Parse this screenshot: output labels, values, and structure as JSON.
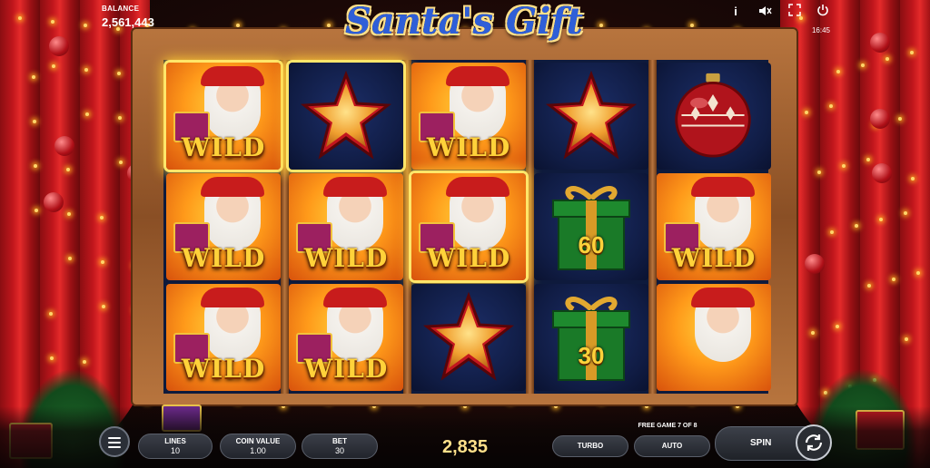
{
  "game": {
    "logo_text": "Santa's Gift",
    "balance_label": "BALANCE",
    "balance_value": "2,561,443",
    "clock": "16:45"
  },
  "top_icons": [
    {
      "name": "info-icon",
      "glyph": "i"
    },
    {
      "name": "mute-icon",
      "glyph": "🔇"
    },
    {
      "name": "fullscreen-icon",
      "glyph": "⤢"
    },
    {
      "name": "power-icon",
      "glyph": "⏻"
    }
  ],
  "reels": [
    [
      {
        "symbol": "santa-wild",
        "label": "WILD",
        "highlighted": true
      },
      {
        "symbol": "santa-wild",
        "label": "WILD",
        "highlighted": false
      },
      {
        "symbol": "santa-wild",
        "label": "WILD",
        "highlighted": false
      }
    ],
    [
      {
        "symbol": "star",
        "label": "",
        "highlighted": true
      },
      {
        "symbol": "santa-wild",
        "label": "WILD",
        "highlighted": false
      },
      {
        "symbol": "santa-wild",
        "label": "WILD",
        "highlighted": false
      }
    ],
    [
      {
        "symbol": "santa-wild",
        "label": "WILD",
        "highlighted": false
      },
      {
        "symbol": "santa-wild",
        "label": "WILD",
        "highlighted": true
      },
      {
        "symbol": "star",
        "label": "",
        "highlighted": false
      }
    ],
    [
      {
        "symbol": "star",
        "label": "",
        "highlighted": false
      },
      {
        "symbol": "gift",
        "label": "60",
        "highlighted": false
      },
      {
        "symbol": "gift",
        "label": "30",
        "highlighted": false
      }
    ],
    [
      {
        "symbol": "bauble",
        "label": "",
        "highlighted": false
      },
      {
        "symbol": "santa-wild",
        "label": "WILD",
        "highlighted": false
      },
      {
        "symbol": "santa",
        "label": "",
        "highlighted": false
      }
    ]
  ],
  "controls": {
    "lines_label": "LINES",
    "lines_value": "10",
    "coin_label": "COIN VALUE",
    "coin_value": "1.00",
    "bet_label": "BET",
    "bet_value": "30",
    "win_value": "2,835",
    "free_game_text": "FREE GAME 7 OF 8",
    "turbo_label": "TURBO",
    "auto_label": "AUTO",
    "spin_label": "SPIN"
  },
  "colors": {
    "highlight": "#ffe66a",
    "wild_text": "#ffd23a",
    "curtain": "#c0161c",
    "logo_blue": "#2f5fd8"
  }
}
